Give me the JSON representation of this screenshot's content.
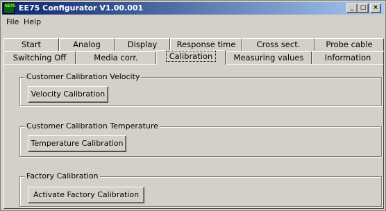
{
  "window": {
    "title": "EE75 Configurator V1.00.001",
    "icon_text": "EE75",
    "minimize": "_",
    "maximize": "□",
    "close": "×"
  },
  "menu": {
    "file": "File",
    "help": "Help"
  },
  "tabs": {
    "row_back": [
      "Start",
      "Analog",
      "Display",
      "Response time",
      "Cross sect.",
      "Probe cable"
    ],
    "row_front": [
      "Switching Off",
      "Media corr.",
      "Calibration",
      "Measuring values",
      "Information"
    ],
    "active": "Calibration"
  },
  "groups": [
    {
      "title": "Customer Calibration Velocity",
      "button": "Velocity Calibration"
    },
    {
      "title": "Customer Calibration Temperature",
      "button": "Temperature Calibration"
    },
    {
      "title": "Factory Calibration",
      "button": "Activate Factory Calibration"
    }
  ],
  "colors": {
    "titlebar_start": "#0a246a",
    "titlebar_end": "#a6caf0",
    "face": "#d4d0c8"
  }
}
